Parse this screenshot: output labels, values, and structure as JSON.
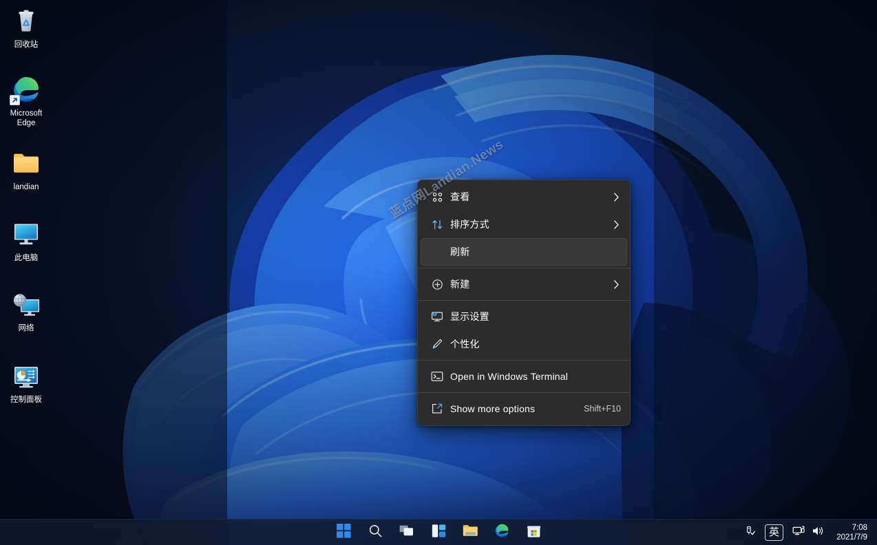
{
  "desktop": {
    "icons": [
      {
        "label": "回收站",
        "icon": "recycle-bin-icon",
        "shortcut": false
      },
      {
        "label": "Microsoft Edge",
        "icon": "edge-icon",
        "shortcut": true
      },
      {
        "label": "landian",
        "icon": "folder-icon",
        "shortcut": false
      },
      {
        "label": "此电脑",
        "icon": "this-pc-icon",
        "shortcut": false
      },
      {
        "label": "网络",
        "icon": "network-icon",
        "shortcut": false
      },
      {
        "label": "控制面板",
        "icon": "control-panel-icon",
        "shortcut": false
      }
    ],
    "wallpaper_name": "windows-11-bloom"
  },
  "watermark": {
    "text": "蓝点网Landian.News"
  },
  "context_menu": {
    "items": [
      {
        "label": "查看",
        "icon": "view-grid-icon",
        "submenu": true,
        "accel": "",
        "highlighted": false,
        "separator_after": false
      },
      {
        "label": "排序方式",
        "icon": "sort-arrows-icon",
        "submenu": true,
        "accel": "",
        "highlighted": false,
        "separator_after": false
      },
      {
        "label": "刷新",
        "icon": "none",
        "submenu": false,
        "accel": "",
        "highlighted": true,
        "separator_after": true
      },
      {
        "label": "新建",
        "icon": "plus-circle-icon",
        "submenu": true,
        "accel": "",
        "highlighted": false,
        "separator_after": true
      },
      {
        "label": "显示设置",
        "icon": "display-settings-icon",
        "submenu": false,
        "accel": "",
        "highlighted": false,
        "separator_after": false
      },
      {
        "label": "个性化",
        "icon": "personalize-brush-icon",
        "submenu": false,
        "accel": "",
        "highlighted": false,
        "separator_after": true
      },
      {
        "label": "Open in Windows Terminal",
        "icon": "terminal-icon",
        "submenu": false,
        "accel": "",
        "highlighted": false,
        "separator_after": true
      },
      {
        "label": "Show more options",
        "icon": "show-more-options-icon",
        "submenu": false,
        "accel": "Shift+F10",
        "highlighted": false,
        "separator_after": false
      }
    ]
  },
  "taskbar": {
    "buttons": [
      {
        "name": "start-button",
        "icon": "windows-logo-icon",
        "label": "开始"
      },
      {
        "name": "search-button",
        "icon": "search-icon",
        "label": "搜索"
      },
      {
        "name": "task-view-button",
        "icon": "task-view-icon",
        "label": "任务视图"
      },
      {
        "name": "widgets-button",
        "icon": "widgets-icon",
        "label": "小组件"
      },
      {
        "name": "file-explorer-button",
        "icon": "folder-icon",
        "label": "文件资源管理器"
      },
      {
        "name": "edge-button",
        "icon": "edge-icon",
        "label": "Microsoft Edge"
      },
      {
        "name": "store-button",
        "icon": "microsoft-store-icon",
        "label": "Microsoft Store"
      }
    ],
    "tray": [
      {
        "name": "safely-remove-hardware",
        "icon": "usb-eject-icon"
      },
      {
        "name": "ime-indicator",
        "icon": "ime-icon",
        "label": "英"
      },
      {
        "name": "network-tray",
        "icon": "network-monitor-icon"
      },
      {
        "name": "volume-tray",
        "icon": "speaker-icon"
      }
    ],
    "clock": {
      "time": "7:08",
      "date": "2021/7/9"
    }
  },
  "colors": {
    "menu_background": "#2c2c2c",
    "menu_highlight": "#383838",
    "menu_border": "#3d3d3d",
    "accent_blue": "#3b8bf0",
    "taskbar_background": "#131c30",
    "text_primary": "#ffffff"
  }
}
